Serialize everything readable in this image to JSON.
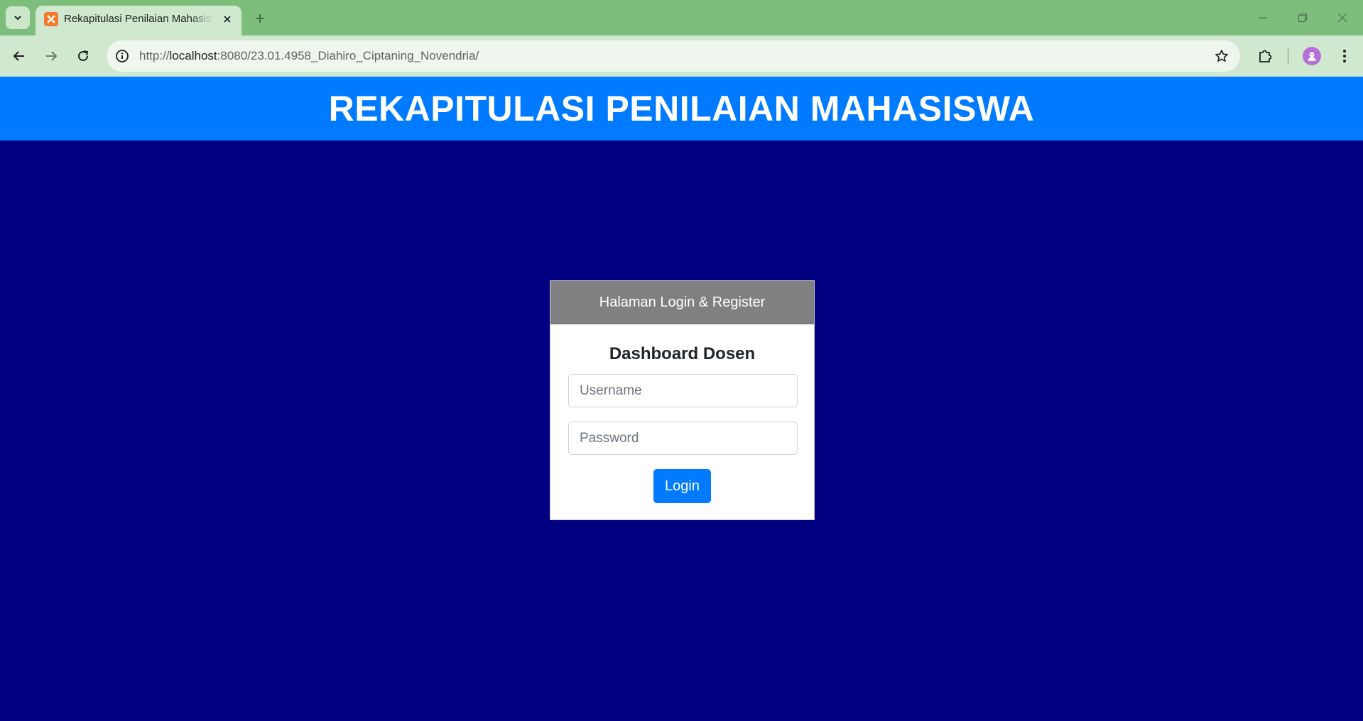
{
  "browser": {
    "tab_title": "Rekapitulasi Penilaian Mahasiswa",
    "url_prefix": "http://",
    "url_host": "localhost",
    "url_rest": ":8080/23.01.4958_Diahiro_Ciptaning_Novendria/",
    "chrome_color": "#7dbe7d",
    "toolbar_color": "#cfe8cf"
  },
  "page": {
    "header_title": "REKAPITULASI PENILAIAN MAHASISWA",
    "header_color": "#007bff",
    "background_color": "#000080"
  },
  "login_card": {
    "header": "Halaman Login & Register",
    "title": "Dashboard Dosen",
    "username_placeholder": "Username",
    "password_placeholder": "Password",
    "username_value": "",
    "password_value": "",
    "login_label": "Login"
  }
}
